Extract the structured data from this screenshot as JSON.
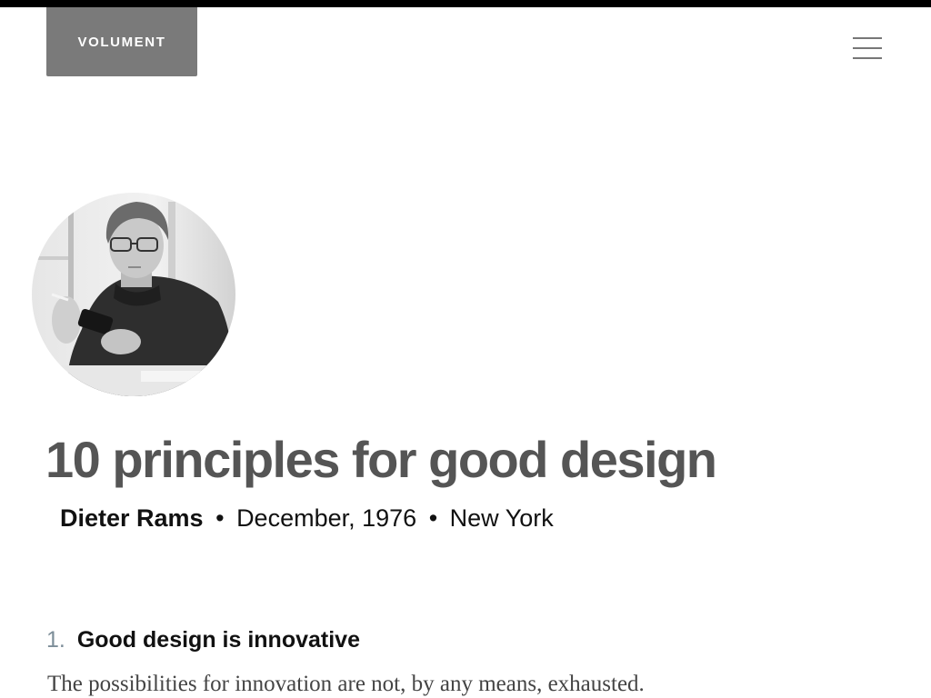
{
  "header": {
    "logo_text": "VOLUMENT",
    "menu_icon": "hamburger-menu-icon"
  },
  "article": {
    "avatar_icon": "author-photo",
    "title": "10 principles for good design",
    "byline": {
      "author": "Dieter Rams",
      "separator": "•",
      "date": "December, 1976",
      "location": "New York"
    },
    "principles": [
      {
        "number": "1.",
        "title": "Good design is innovative",
        "text": "The possibilities for innovation are not, by any means, exhausted."
      }
    ]
  },
  "colors": {
    "logo_background": "#7a7a7a",
    "title_color": "#555555",
    "number_color": "#7d8e99",
    "top_bar": "#000000"
  }
}
